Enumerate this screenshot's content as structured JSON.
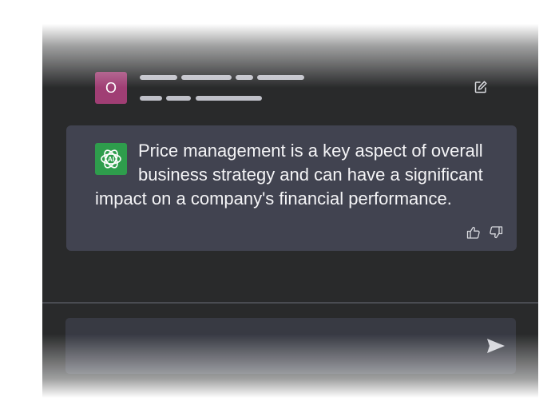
{
  "user": {
    "avatar_letter": "O",
    "avatar_color": "#a03e74",
    "edit_icon": "edit-pencil-icon"
  },
  "assistant": {
    "logo_label": "AI",
    "logo_color": "#2e9d4c",
    "message": "Price management is a key aspect of overall business strategy and can have a significant impact on a company's financial performance.",
    "feedback_icons": [
      "thumbs-up-icon",
      "thumbs-down-icon"
    ]
  },
  "composer": {
    "value": "",
    "placeholder": "",
    "send_icon": "send-icon"
  },
  "colors": {
    "panel_bg": "#292a2b",
    "card_bg": "#414350",
    "input_bg": "#383a43",
    "text": "#f4f4f6"
  }
}
